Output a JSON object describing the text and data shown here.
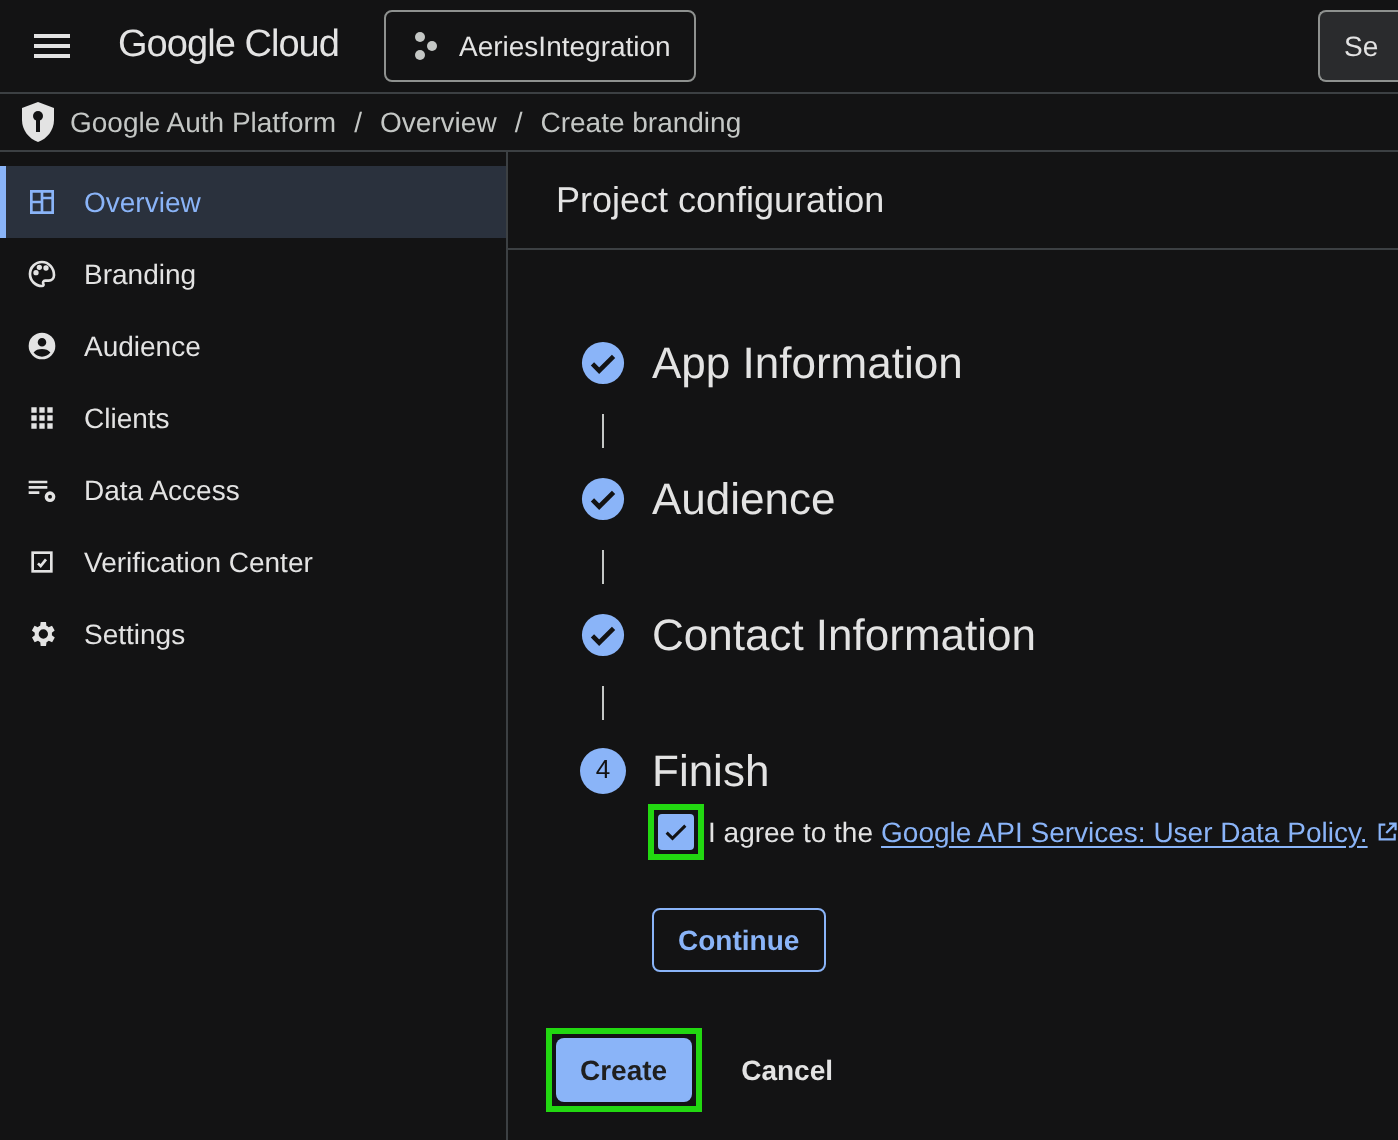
{
  "header": {
    "logo": "Google Cloud",
    "project": "AeriesIntegration",
    "right_button": "Se"
  },
  "breadcrumb": [
    "Google Auth Platform",
    "Overview",
    "Create branding"
  ],
  "breadcrumb_separator": "/",
  "sidebar": {
    "items": [
      {
        "label": "Overview",
        "kind": "dashboard",
        "selected": true
      },
      {
        "label": "Branding",
        "kind": "palette",
        "selected": false
      },
      {
        "label": "Audience",
        "kind": "person",
        "selected": false
      },
      {
        "label": "Clients",
        "kind": "grid",
        "selected": false
      },
      {
        "label": "Data Access",
        "kind": "list-gear",
        "selected": false
      },
      {
        "label": "Verification Center",
        "kind": "check-box",
        "selected": false
      },
      {
        "label": "Settings",
        "kind": "gear",
        "selected": false
      }
    ]
  },
  "panel": {
    "title": "Project configuration"
  },
  "steps": [
    {
      "kind": "done",
      "title": "App Information"
    },
    {
      "kind": "done",
      "title": "Audience"
    },
    {
      "kind": "done",
      "title": "Contact Information"
    },
    {
      "kind": "current",
      "number": "4",
      "title": "Finish"
    }
  ],
  "agreement": {
    "checked": true,
    "highlighted": true,
    "text": "I agree to the",
    "link": "Google API Services: User Data Policy."
  },
  "continue_button": "Continue",
  "create_button": {
    "label": "Create",
    "highlighted": true
  },
  "cancel_button": "Cancel"
}
